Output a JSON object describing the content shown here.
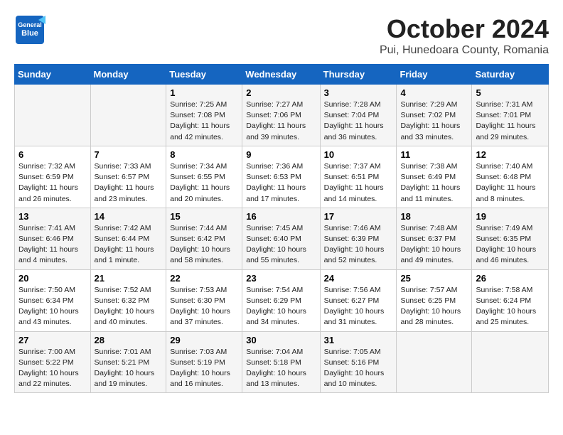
{
  "header": {
    "logo_general": "General",
    "logo_blue": "Blue",
    "month": "October 2024",
    "location": "Pui, Hunedoara County, Romania"
  },
  "days_of_week": [
    "Sunday",
    "Monday",
    "Tuesday",
    "Wednesday",
    "Thursday",
    "Friday",
    "Saturday"
  ],
  "weeks": [
    [
      {
        "day": null,
        "data": null
      },
      {
        "day": null,
        "data": null
      },
      {
        "day": "1",
        "data": "Sunrise: 7:25 AM\nSunset: 7:08 PM\nDaylight: 11 hours and 42 minutes."
      },
      {
        "day": "2",
        "data": "Sunrise: 7:27 AM\nSunset: 7:06 PM\nDaylight: 11 hours and 39 minutes."
      },
      {
        "day": "3",
        "data": "Sunrise: 7:28 AM\nSunset: 7:04 PM\nDaylight: 11 hours and 36 minutes."
      },
      {
        "day": "4",
        "data": "Sunrise: 7:29 AM\nSunset: 7:02 PM\nDaylight: 11 hours and 33 minutes."
      },
      {
        "day": "5",
        "data": "Sunrise: 7:31 AM\nSunset: 7:01 PM\nDaylight: 11 hours and 29 minutes."
      }
    ],
    [
      {
        "day": "6",
        "data": "Sunrise: 7:32 AM\nSunset: 6:59 PM\nDaylight: 11 hours and 26 minutes."
      },
      {
        "day": "7",
        "data": "Sunrise: 7:33 AM\nSunset: 6:57 PM\nDaylight: 11 hours and 23 minutes."
      },
      {
        "day": "8",
        "data": "Sunrise: 7:34 AM\nSunset: 6:55 PM\nDaylight: 11 hours and 20 minutes."
      },
      {
        "day": "9",
        "data": "Sunrise: 7:36 AM\nSunset: 6:53 PM\nDaylight: 11 hours and 17 minutes."
      },
      {
        "day": "10",
        "data": "Sunrise: 7:37 AM\nSunset: 6:51 PM\nDaylight: 11 hours and 14 minutes."
      },
      {
        "day": "11",
        "data": "Sunrise: 7:38 AM\nSunset: 6:49 PM\nDaylight: 11 hours and 11 minutes."
      },
      {
        "day": "12",
        "data": "Sunrise: 7:40 AM\nSunset: 6:48 PM\nDaylight: 11 hours and 8 minutes."
      }
    ],
    [
      {
        "day": "13",
        "data": "Sunrise: 7:41 AM\nSunset: 6:46 PM\nDaylight: 11 hours and 4 minutes."
      },
      {
        "day": "14",
        "data": "Sunrise: 7:42 AM\nSunset: 6:44 PM\nDaylight: 11 hours and 1 minute."
      },
      {
        "day": "15",
        "data": "Sunrise: 7:44 AM\nSunset: 6:42 PM\nDaylight: 10 hours and 58 minutes."
      },
      {
        "day": "16",
        "data": "Sunrise: 7:45 AM\nSunset: 6:40 PM\nDaylight: 10 hours and 55 minutes."
      },
      {
        "day": "17",
        "data": "Sunrise: 7:46 AM\nSunset: 6:39 PM\nDaylight: 10 hours and 52 minutes."
      },
      {
        "day": "18",
        "data": "Sunrise: 7:48 AM\nSunset: 6:37 PM\nDaylight: 10 hours and 49 minutes."
      },
      {
        "day": "19",
        "data": "Sunrise: 7:49 AM\nSunset: 6:35 PM\nDaylight: 10 hours and 46 minutes."
      }
    ],
    [
      {
        "day": "20",
        "data": "Sunrise: 7:50 AM\nSunset: 6:34 PM\nDaylight: 10 hours and 43 minutes."
      },
      {
        "day": "21",
        "data": "Sunrise: 7:52 AM\nSunset: 6:32 PM\nDaylight: 10 hours and 40 minutes."
      },
      {
        "day": "22",
        "data": "Sunrise: 7:53 AM\nSunset: 6:30 PM\nDaylight: 10 hours and 37 minutes."
      },
      {
        "day": "23",
        "data": "Sunrise: 7:54 AM\nSunset: 6:29 PM\nDaylight: 10 hours and 34 minutes."
      },
      {
        "day": "24",
        "data": "Sunrise: 7:56 AM\nSunset: 6:27 PM\nDaylight: 10 hours and 31 minutes."
      },
      {
        "day": "25",
        "data": "Sunrise: 7:57 AM\nSunset: 6:25 PM\nDaylight: 10 hours and 28 minutes."
      },
      {
        "day": "26",
        "data": "Sunrise: 7:58 AM\nSunset: 6:24 PM\nDaylight: 10 hours and 25 minutes."
      }
    ],
    [
      {
        "day": "27",
        "data": "Sunrise: 7:00 AM\nSunset: 5:22 PM\nDaylight: 10 hours and 22 minutes."
      },
      {
        "day": "28",
        "data": "Sunrise: 7:01 AM\nSunset: 5:21 PM\nDaylight: 10 hours and 19 minutes."
      },
      {
        "day": "29",
        "data": "Sunrise: 7:03 AM\nSunset: 5:19 PM\nDaylight: 10 hours and 16 minutes."
      },
      {
        "day": "30",
        "data": "Sunrise: 7:04 AM\nSunset: 5:18 PM\nDaylight: 10 hours and 13 minutes."
      },
      {
        "day": "31",
        "data": "Sunrise: 7:05 AM\nSunset: 5:16 PM\nDaylight: 10 hours and 10 minutes."
      },
      {
        "day": null,
        "data": null
      },
      {
        "day": null,
        "data": null
      }
    ]
  ]
}
